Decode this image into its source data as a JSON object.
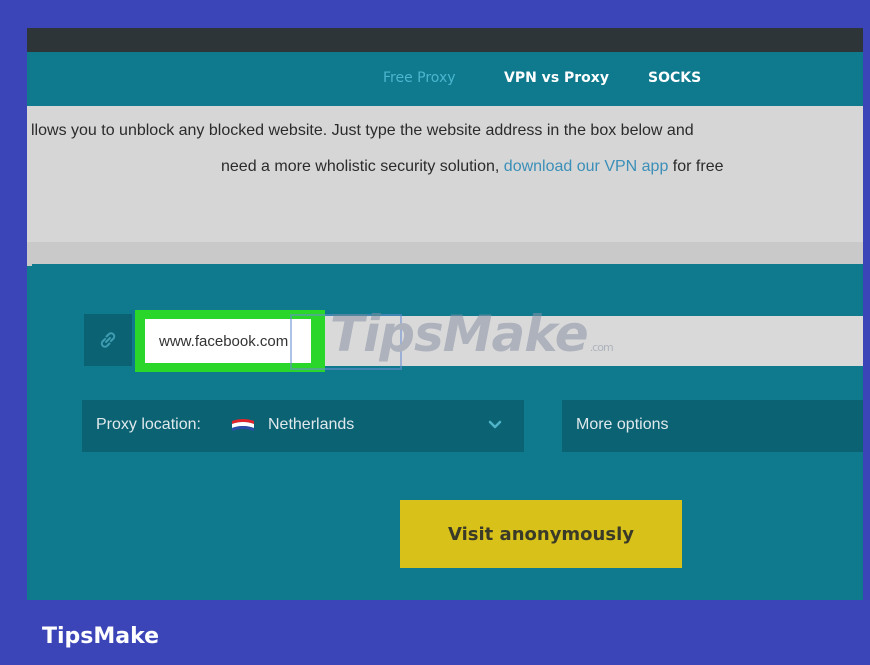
{
  "nav": {
    "links": [
      "Free Proxy",
      "VPN vs Proxy",
      "SOCKS"
    ]
  },
  "intro": {
    "line1": "llows you to unblock any blocked website. Just type the website address in the box below and",
    "line2_before": "need a more wholistic security solution, ",
    "line2_link": "download our VPN app",
    "line2_after": " for free"
  },
  "form": {
    "url_value": "www.facebook.com",
    "proxy_location_label": "Proxy location:",
    "proxy_location_value": "Netherlands",
    "more_options_label": "More options",
    "visit_button_label": "Visit anonymously"
  },
  "watermark": {
    "text": "TipsMake",
    "suffix": ".com"
  },
  "footer": {
    "brand": "TipsMake"
  },
  "colors": {
    "frame": "#3b45b8",
    "teal": "#0f7a8e",
    "teal_dark": "#0b6273",
    "highlight_green": "#2bd62b",
    "button_yellow": "#d8c21a",
    "link_blue": "#3b8fb8"
  },
  "icons": [
    "link-icon",
    "netherlands-flag-icon",
    "chevron-down-icon"
  ]
}
